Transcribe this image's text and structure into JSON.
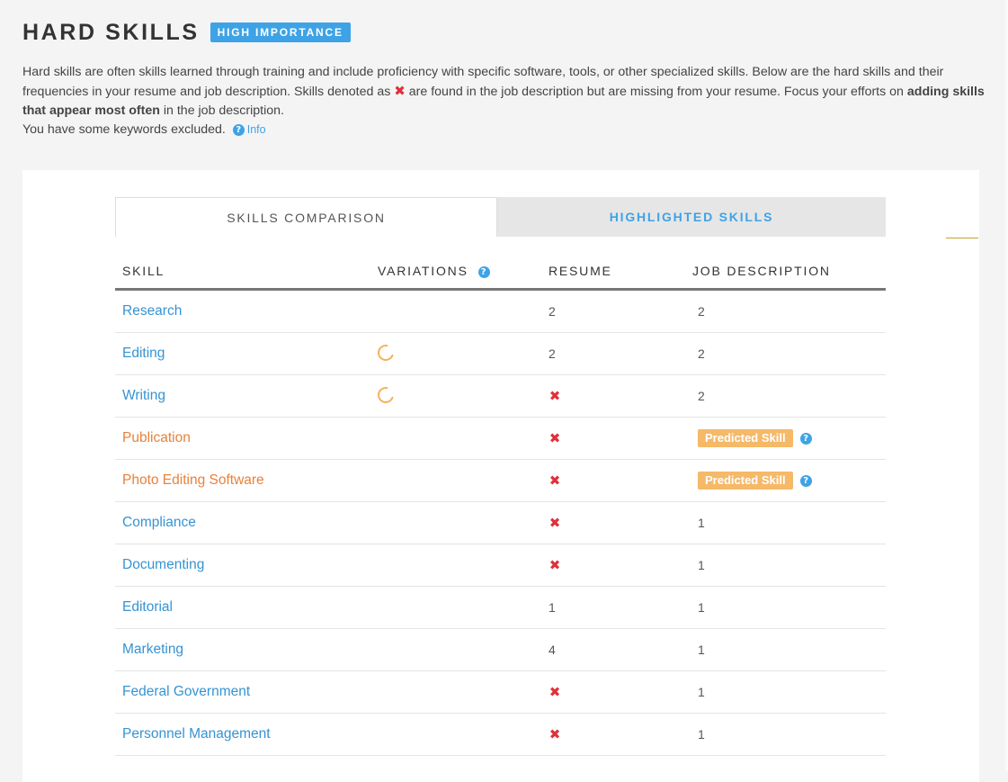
{
  "header": {
    "title": "HARD SKILLS",
    "badge": "HIGH IMPORTANCE"
  },
  "description": {
    "part1": "Hard skills are often skills learned through training and include proficiency with specific software, tools, or other specialized skills. Below are the hard skills and their frequencies in your resume and job description. Skills denoted as ",
    "mark": "✖",
    "part2": " are found in the job description but are missing from your resume. Focus your efforts on ",
    "bold": "adding skills that appear most often",
    "part3": " in the job description.",
    "excluded": "You have some keywords excluded.",
    "info_link": "Info"
  },
  "tabs": {
    "skills_comparison": "SKILLS COMPARISON",
    "highlighted_skills": "HIGHLIGHTED SKILLS"
  },
  "table": {
    "headers": {
      "skill": "SKILL",
      "variations": "VARIATIONS",
      "resume": "RESUME",
      "job_description": "JOB DESCRIPTION"
    },
    "missing_mark": "✖",
    "help_glyph": "?",
    "rows": [
      {
        "skill": "Research",
        "color": "#3593d3",
        "variations": false,
        "resume": "2",
        "resume_missing": false,
        "job": "2",
        "predicted": false
      },
      {
        "skill": "Editing",
        "color": "#3593d3",
        "variations": true,
        "resume": "2",
        "resume_missing": false,
        "job": "2",
        "predicted": false
      },
      {
        "skill": "Writing",
        "color": "#3593d3",
        "variations": true,
        "resume": "",
        "resume_missing": true,
        "job": "2",
        "predicted": false
      },
      {
        "skill": "Publication",
        "color": "#e8813a",
        "variations": false,
        "resume": "",
        "resume_missing": true,
        "job": "Predicted Skill",
        "predicted": true
      },
      {
        "skill": "Photo Editing Software",
        "color": "#e8813a",
        "variations": false,
        "resume": "",
        "resume_missing": true,
        "job": "Predicted Skill",
        "predicted": true
      },
      {
        "skill": "Compliance",
        "color": "#3593d3",
        "variations": false,
        "resume": "",
        "resume_missing": true,
        "job": "1",
        "predicted": false
      },
      {
        "skill": "Documenting",
        "color": "#3593d3",
        "variations": false,
        "resume": "",
        "resume_missing": true,
        "job": "1",
        "predicted": false
      },
      {
        "skill": "Editorial",
        "color": "#3593d3",
        "variations": false,
        "resume": "1",
        "resume_missing": false,
        "job": "1",
        "predicted": false
      },
      {
        "skill": "Marketing",
        "color": "#3593d3",
        "variations": false,
        "resume": "4",
        "resume_missing": false,
        "job": "1",
        "predicted": false
      },
      {
        "skill": "Federal Government",
        "color": "#3593d3",
        "variations": false,
        "resume": "",
        "resume_missing": true,
        "job": "1",
        "predicted": false
      },
      {
        "skill": "Personnel Management",
        "color": "#3593d3",
        "variations": false,
        "resume": "",
        "resume_missing": true,
        "job": "1",
        "predicted": false
      }
    ]
  }
}
